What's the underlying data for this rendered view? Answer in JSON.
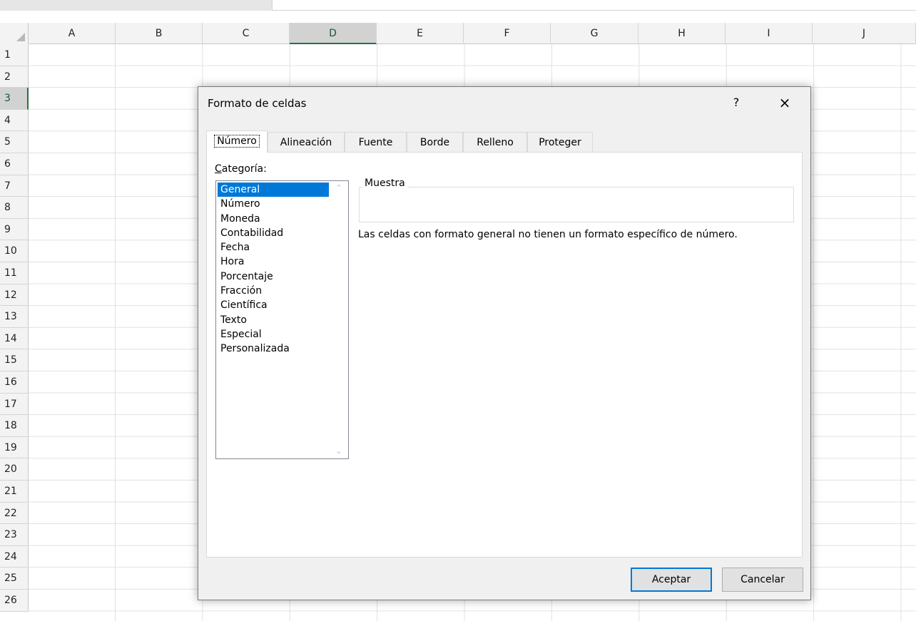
{
  "spreadsheet": {
    "columns": [
      "A",
      "B",
      "C",
      "D",
      "E",
      "F",
      "G",
      "H",
      "I",
      "J"
    ],
    "selected_column": "D",
    "rows": [
      "1",
      "2",
      "3",
      "4",
      "5",
      "6",
      "7",
      "8",
      "9",
      "10",
      "11",
      "12",
      "13",
      "14",
      "15",
      "16",
      "17",
      "18",
      "19",
      "20",
      "21",
      "22",
      "23",
      "24",
      "25",
      "26"
    ],
    "selected_row": "3"
  },
  "dialog": {
    "title": "Formato de celdas",
    "help_glyph": "?",
    "close_glyph": "×",
    "tabs": [
      {
        "label": "Número",
        "active": true
      },
      {
        "label": "Alineación",
        "active": false
      },
      {
        "label": "Fuente",
        "active": false
      },
      {
        "label": "Borde",
        "active": false
      },
      {
        "label": "Relleno",
        "active": false
      },
      {
        "label": "Proteger",
        "active": false
      }
    ],
    "category_label_underlined": "C",
    "category_label_rest": "ategoría:",
    "categories": [
      "General",
      "Número",
      "Moneda",
      "Contabilidad",
      "Fecha",
      "Hora",
      "Porcentaje",
      "Fracción",
      "Científica",
      "Texto",
      "Especial",
      "Personalizada"
    ],
    "selected_category": "General",
    "sample_label": "Muestra",
    "description": "Las celdas con formato general no tienen un formato específico de número.",
    "ok_label": "Aceptar",
    "cancel_label": "Cancelar",
    "icons": {
      "scroll_up": "chevron-up-icon",
      "scroll_down": "chevron-down-icon"
    }
  },
  "colors": {
    "selection": "#0078d7",
    "excel_green": "#217346"
  }
}
